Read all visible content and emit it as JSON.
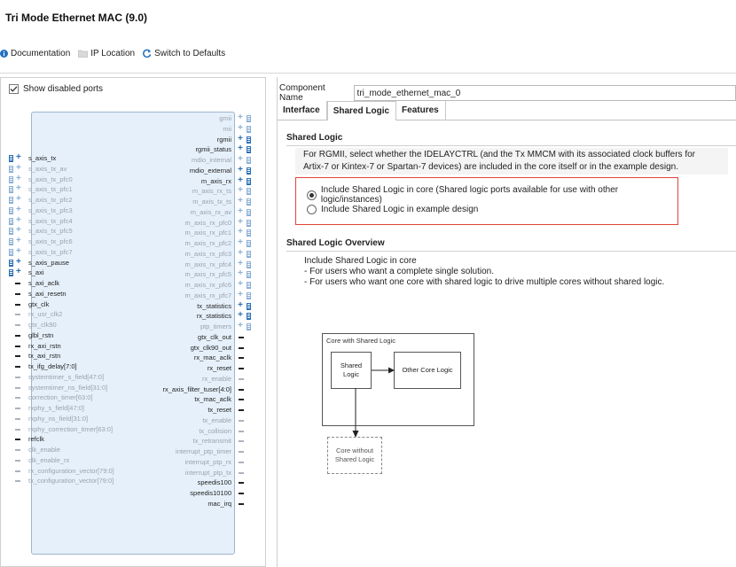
{
  "window": {
    "title": "Tri Mode Ethernet MAC (9.0)"
  },
  "toolbar": {
    "documentation": "Documentation",
    "ip_location": "IP Location",
    "switch_defaults": "Switch to Defaults"
  },
  "left_panel": {
    "show_disabled_label": "Show disabled ports",
    "show_disabled_checked": true,
    "ports_left": [
      {
        "name": "s_axis_tx",
        "enabled": true,
        "kind": "bus"
      },
      {
        "name": "s_axis_tx_av",
        "enabled": false,
        "kind": "bus"
      },
      {
        "name": "s_axis_tx_pfc0",
        "enabled": false,
        "kind": "bus"
      },
      {
        "name": "s_axis_tx_pfc1",
        "enabled": false,
        "kind": "bus"
      },
      {
        "name": "s_axis_tx_pfc2",
        "enabled": false,
        "kind": "bus"
      },
      {
        "name": "s_axis_tx_pfc3",
        "enabled": false,
        "kind": "bus"
      },
      {
        "name": "s_axis_tx_pfc4",
        "enabled": false,
        "kind": "bus"
      },
      {
        "name": "s_axis_tx_pfc5",
        "enabled": false,
        "kind": "bus"
      },
      {
        "name": "s_axis_tx_pfc6",
        "enabled": false,
        "kind": "bus"
      },
      {
        "name": "s_axis_tx_pfc7",
        "enabled": false,
        "kind": "bus"
      },
      {
        "name": "s_axis_pause",
        "enabled": true,
        "kind": "bus"
      },
      {
        "name": "s_axi",
        "enabled": true,
        "kind": "bus"
      },
      {
        "name": "s_axi_aclk",
        "enabled": true,
        "kind": "wire"
      },
      {
        "name": "s_axi_resetn",
        "enabled": true,
        "kind": "wire"
      },
      {
        "name": "gtx_clk",
        "enabled": true,
        "kind": "wire"
      },
      {
        "name": "rx_usr_clk2",
        "enabled": false,
        "kind": "wire"
      },
      {
        "name": "gtx_clk90",
        "enabled": false,
        "kind": "wire"
      },
      {
        "name": "glbl_rstn",
        "enabled": true,
        "kind": "wire"
      },
      {
        "name": "rx_axi_rstn",
        "enabled": true,
        "kind": "wire"
      },
      {
        "name": "tx_axi_rstn",
        "enabled": true,
        "kind": "wire"
      },
      {
        "name": "tx_ifg_delay[7:0]",
        "enabled": true,
        "kind": "wire"
      },
      {
        "name": "systemtimer_s_field[47:0]",
        "enabled": false,
        "kind": "wire"
      },
      {
        "name": "systemtimer_ns_field[31:0]",
        "enabled": false,
        "kind": "wire"
      },
      {
        "name": "correction_timer[63:0]",
        "enabled": false,
        "kind": "wire"
      },
      {
        "name": "rxphy_s_field[47:0]",
        "enabled": false,
        "kind": "wire"
      },
      {
        "name": "rxphy_ns_field[31:0]",
        "enabled": false,
        "kind": "wire"
      },
      {
        "name": "rxphy_correction_timer[63:0]",
        "enabled": false,
        "kind": "wire"
      },
      {
        "name": "refclk",
        "enabled": true,
        "kind": "wire"
      },
      {
        "name": "clk_enable",
        "enabled": false,
        "kind": "wire"
      },
      {
        "name": "clk_enable_rx",
        "enabled": false,
        "kind": "wire"
      },
      {
        "name": "rx_configuration_vector[79:0]",
        "enabled": false,
        "kind": "wire"
      },
      {
        "name": "tx_configuration_vector[79:0]",
        "enabled": false,
        "kind": "wire"
      }
    ],
    "ports_right": [
      {
        "name": "gmii",
        "enabled": false,
        "kind": "bus"
      },
      {
        "name": "mii",
        "enabled": false,
        "kind": "bus"
      },
      {
        "name": "rgmii",
        "enabled": true,
        "kind": "bus"
      },
      {
        "name": "rgmii_status",
        "enabled": true,
        "kind": "bus"
      },
      {
        "name": "mdio_internal",
        "enabled": false,
        "kind": "bus"
      },
      {
        "name": "mdio_external",
        "enabled": true,
        "kind": "bus"
      },
      {
        "name": "m_axis_rx",
        "enabled": true,
        "kind": "bus"
      },
      {
        "name": "m_axis_rx_ts",
        "enabled": false,
        "kind": "bus"
      },
      {
        "name": "m_axis_tx_ts",
        "enabled": false,
        "kind": "bus"
      },
      {
        "name": "m_axis_rx_av",
        "enabled": false,
        "kind": "bus"
      },
      {
        "name": "m_axis_rx_pfc0",
        "enabled": false,
        "kind": "bus"
      },
      {
        "name": "m_axis_rx_pfc1",
        "enabled": false,
        "kind": "bus"
      },
      {
        "name": "m_axis_rx_pfc2",
        "enabled": false,
        "kind": "bus"
      },
      {
        "name": "m_axis_rx_pfc3",
        "enabled": false,
        "kind": "bus"
      },
      {
        "name": "m_axis_rx_pfc4",
        "enabled": false,
        "kind": "bus"
      },
      {
        "name": "m_axis_rx_pfc5",
        "enabled": false,
        "kind": "bus"
      },
      {
        "name": "m_axis_rx_pfc6",
        "enabled": false,
        "kind": "bus"
      },
      {
        "name": "m_axis_rx_pfc7",
        "enabled": false,
        "kind": "bus"
      },
      {
        "name": "tx_statistics",
        "enabled": true,
        "kind": "bus"
      },
      {
        "name": "rx_statistics",
        "enabled": true,
        "kind": "bus"
      },
      {
        "name": "ptp_timers",
        "enabled": false,
        "kind": "bus"
      },
      {
        "name": "gtx_clk_out",
        "enabled": true,
        "kind": "wire"
      },
      {
        "name": "gtx_clk90_out",
        "enabled": true,
        "kind": "wire"
      },
      {
        "name": "rx_mac_aclk",
        "enabled": true,
        "kind": "wire"
      },
      {
        "name": "rx_reset",
        "enabled": true,
        "kind": "wire"
      },
      {
        "name": "rx_enable",
        "enabled": false,
        "kind": "wire"
      },
      {
        "name": "rx_axis_filter_tuser[4:0]",
        "enabled": true,
        "kind": "wire"
      },
      {
        "name": "tx_mac_aclk",
        "enabled": true,
        "kind": "wire"
      },
      {
        "name": "tx_reset",
        "enabled": true,
        "kind": "wire"
      },
      {
        "name": "tx_enable",
        "enabled": false,
        "kind": "wire"
      },
      {
        "name": "tx_collision",
        "enabled": false,
        "kind": "wire"
      },
      {
        "name": "tx_retransmit",
        "enabled": false,
        "kind": "wire"
      },
      {
        "name": "interrupt_ptp_timer",
        "enabled": false,
        "kind": "wire"
      },
      {
        "name": "interrupt_ptp_rx",
        "enabled": false,
        "kind": "wire"
      },
      {
        "name": "interrupt_ptp_tx",
        "enabled": false,
        "kind": "wire"
      },
      {
        "name": "speedis100",
        "enabled": true,
        "kind": "wire"
      },
      {
        "name": "speedis10100",
        "enabled": true,
        "kind": "wire"
      },
      {
        "name": "mac_irq",
        "enabled": true,
        "kind": "wire"
      }
    ]
  },
  "right_panel": {
    "component_name_label": "Component Name",
    "component_name_value": "tri_mode_ethernet_mac_0",
    "tabs": [
      "Interface",
      "Shared Logic",
      "Features"
    ],
    "active_tab": "Shared Logic",
    "shared_logic": {
      "title": "Shared Logic",
      "description_line1": "For RGMII, select  whether the IDELAYCTRL (and the Tx MMCM with its associated clock buffers for",
      "description_line2": "Artix-7 or Kintex-7 or Spartan-7 devices) are included in the core itself or in the example design.",
      "option_core": "Include Shared Logic in core (Shared logic ports available for use with other logic/instances)",
      "option_example": "Include Shared Logic in example design",
      "selected": "core"
    },
    "overview": {
      "title": "Shared Logic Overview",
      "line1": "Include Shared Logic in core",
      "line2": "- For users who want a complete single solution.",
      "line3": "- For users who want one core with shared logic to drive multiple cores without shared logic."
    },
    "diagram": {
      "outer_label": "Core with Shared Logic",
      "shared_logic_label": "Shared Logic",
      "other_core_label": "Other Core Logic",
      "core_without_label": "Core without Shared Logic"
    }
  }
}
